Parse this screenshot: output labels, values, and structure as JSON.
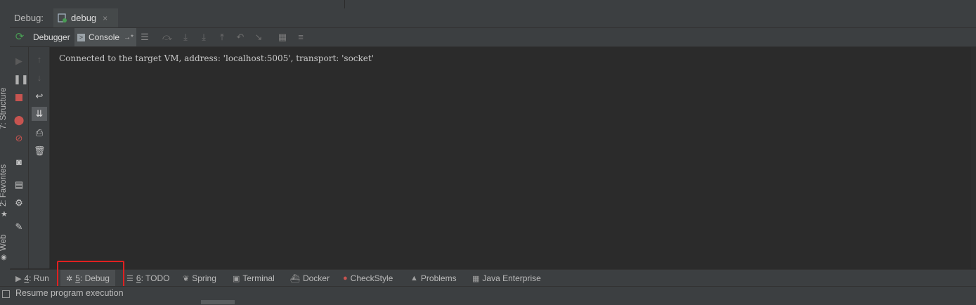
{
  "left_strip": {
    "tabs": [
      {
        "label": "7: Structure",
        "icon": "structure-icon"
      },
      {
        "label": "2: Favorites",
        "icon": "star-icon"
      },
      {
        "label": "Web",
        "icon": "web-icon"
      }
    ]
  },
  "header": {
    "label": "Debug:",
    "session_tab": {
      "name": "debug",
      "close": "×",
      "icon": "debug-config-icon"
    }
  },
  "toolbar": {
    "tabs": [
      {
        "label": "Debugger"
      },
      {
        "label": "Console",
        "suffix": "→*"
      }
    ],
    "icons": [
      "rerun-icon",
      "menu-icon",
      "step-over-icon",
      "step-into-icon",
      "force-step-into-icon",
      "step-out-icon",
      "drop-frame-icon",
      "run-to-cursor-icon",
      "evaluate-icon",
      "trace-icon"
    ]
  },
  "sidebar1": {
    "icons": [
      "resume-icon",
      "pause-icon",
      "stop-icon",
      "view-breakpoints-icon",
      "mute-breakpoints-icon",
      "camera-icon",
      "layout-icon",
      "settings-icon",
      "pin-icon"
    ]
  },
  "sidebar2": {
    "icons": [
      "up-arrow-icon",
      "down-arrow-icon",
      "soft-wrap-icon",
      "scroll-to-end-icon",
      "print-icon",
      "clear-icon"
    ]
  },
  "console": {
    "line": "Connected to the target VM, address: 'localhost:5005', transport: 'socket'"
  },
  "bottom_tabs": [
    {
      "num": "4",
      "label": ": Run",
      "icon": "run-icon"
    },
    {
      "num": "5",
      "label": ": Debug",
      "icon": "debug-icon",
      "active": true
    },
    {
      "num": "6",
      "label": ": TODO",
      "icon": "todo-icon"
    },
    {
      "num": "",
      "label": "Spring",
      "icon": "spring-icon"
    },
    {
      "num": "",
      "label": "Terminal",
      "icon": "terminal-icon"
    },
    {
      "num": "",
      "label": "Docker",
      "icon": "docker-icon"
    },
    {
      "num": "",
      "label": "CheckStyle",
      "icon": "checkstyle-icon"
    },
    {
      "num": "",
      "label": "Problems",
      "icon": "warning-icon"
    },
    {
      "num": "",
      "label": "Java Enterprise",
      "icon": "java-enterprise-icon"
    }
  ],
  "status": {
    "text": "Resume program execution"
  },
  "colors": {
    "highlight": "#e02020",
    "stop": "#c75450",
    "green": "#499c54"
  }
}
